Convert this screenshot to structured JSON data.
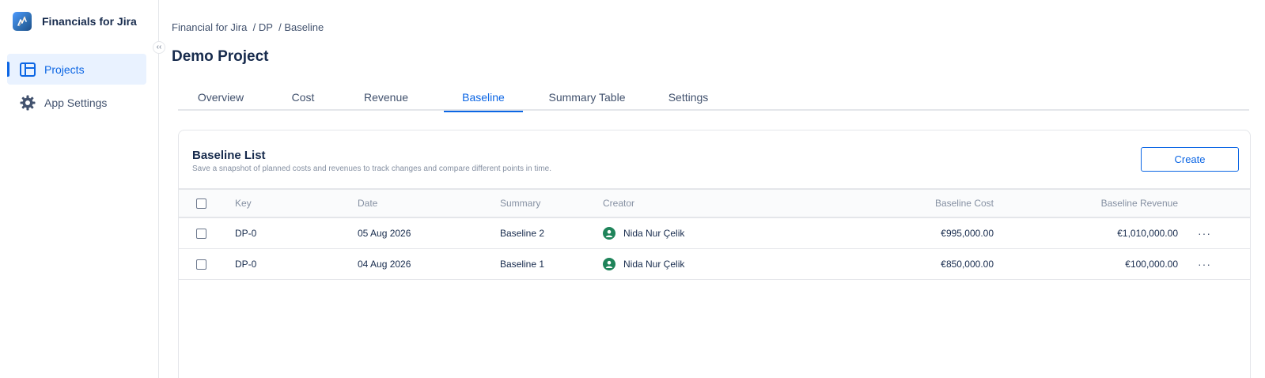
{
  "app": {
    "title": "Financials for Jira",
    "logo_icon": "chart-logo-icon"
  },
  "sidebar": {
    "collapse_label": "‹‹",
    "items": [
      {
        "label": "Projects",
        "icon": "table-layout-icon",
        "active": true
      },
      {
        "label": "App Settings",
        "icon": "gear-icon",
        "active": false
      }
    ]
  },
  "breadcrumb": {
    "root": "Financial for Jira",
    "project": "/ DP",
    "current": "/ Baseline"
  },
  "page": {
    "title": "Demo Project"
  },
  "tabs": [
    {
      "label": "Overview",
      "active": false
    },
    {
      "label": "Cost",
      "active": false
    },
    {
      "label": "Revenue",
      "active": false
    },
    {
      "label": "Baseline",
      "active": true
    },
    {
      "label": "Summary Table",
      "active": false
    },
    {
      "label": "Settings",
      "active": false
    }
  ],
  "baseline_list": {
    "title": "Baseline List",
    "subtitle": "Save a snapshot of planned costs and revenues to track changes and compare different points in time.",
    "create_label": "Create",
    "columns": {
      "key": "Key",
      "date": "Date",
      "summary": "Summary",
      "creator": "Creator",
      "baseline_cost": "Baseline Cost",
      "baseline_revenue": "Baseline Revenue"
    },
    "rows": [
      {
        "key": "DP-0",
        "date": "05 Aug 2026",
        "summary": "Baseline 2",
        "creator": "Nida Nur Çelik",
        "baseline_cost": "€995,000.00",
        "baseline_revenue": "€1,010,000.00",
        "more": "···"
      },
      {
        "key": "DP-0",
        "date": "04 Aug 2026",
        "summary": "Baseline 1",
        "creator": "Nida Nur Çelik",
        "baseline_cost": "€850,000.00",
        "baseline_revenue": "€100,000.00",
        "more": "···"
      }
    ]
  },
  "colors": {
    "accent": "#0c66e4",
    "active_nav_bg": "#e9f2ff",
    "avatar": "#1f845a",
    "text": "#172b4d",
    "muted": "#8590a2"
  }
}
